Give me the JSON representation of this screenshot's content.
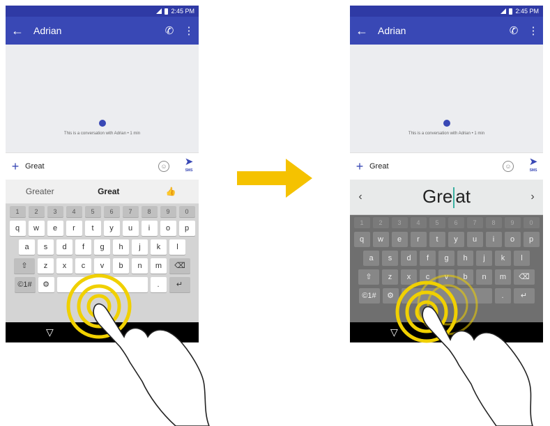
{
  "status": {
    "time": "2:45 PM"
  },
  "appbar": {
    "contact": "Adrian"
  },
  "conversation": {
    "info": "This is a conversation with Adrian • 1 min"
  },
  "compose": {
    "text": "Great",
    "send_label": "SMS"
  },
  "suggestions": {
    "left": "Greater",
    "middle": "Great"
  },
  "gesture_preview": {
    "word_before_cursor": "Gre",
    "word_after_cursor": "at"
  },
  "keyboard": {
    "number_row": [
      "1",
      "2",
      "3",
      "4",
      "5",
      "6",
      "7",
      "8",
      "9",
      "0"
    ],
    "row1": [
      "q",
      "w",
      "e",
      "r",
      "t",
      "y",
      "u",
      "i",
      "o",
      "p"
    ],
    "row2": [
      "a",
      "s",
      "d",
      "f",
      "g",
      "h",
      "j",
      "k",
      "l"
    ],
    "row3": [
      "z",
      "x",
      "c",
      "v",
      "b",
      "n",
      "m"
    ],
    "symbols_label": "©1#"
  },
  "colors": {
    "appbar": "#3948b5",
    "status": "#2f3aa5",
    "arrow": "#f5c200",
    "gesture_rings": "#f0d000"
  }
}
